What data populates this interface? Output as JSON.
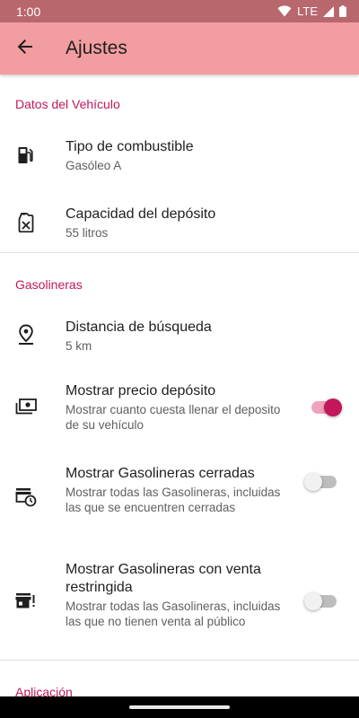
{
  "status_bar": {
    "time": "1:00",
    "network": "LTE"
  },
  "app_bar": {
    "title": "Ajustes"
  },
  "sections": {
    "vehicle": {
      "header": "Datos del Vehículo"
    },
    "stations": {
      "header": "Gasolineras"
    },
    "app": {
      "header": "Aplicación"
    }
  },
  "prefs": {
    "fuel_type": {
      "title": "Tipo de combustible",
      "summary": "Gasóleo A",
      "icon": "fuel-pump-icon"
    },
    "tank_capacity": {
      "title": "Capacidad del depósito",
      "summary": "55 litros",
      "icon": "jerrycan-icon"
    },
    "search_distance": {
      "title": "Distancia de búsqueda",
      "summary": "5 km",
      "icon": "map-pin-icon"
    },
    "show_tank_price": {
      "title": "Mostrar precio depósito",
      "summary": "Mostrar cuanto cuesta llenar el deposito de su vehículo",
      "enabled": true,
      "icon": "money-icon"
    },
    "show_closed": {
      "title": "Mostrar Gasolineras cerradas",
      "summary": "Mostrar todas las Gasolineras, incluidas las que se encuentren cerradas",
      "enabled": false,
      "icon": "store-clock-icon"
    },
    "show_restricted": {
      "title": "Mostrar Gasolineras con venta restringida",
      "summary": "Mostrar todas las Gasolineras, incluidas las que no tienen venta al público",
      "enabled": false,
      "icon": "store-alert-icon"
    }
  },
  "colors": {
    "accent": "#c2185b",
    "app_bar": "#f29d9f",
    "status_bar": "#b8676d"
  }
}
